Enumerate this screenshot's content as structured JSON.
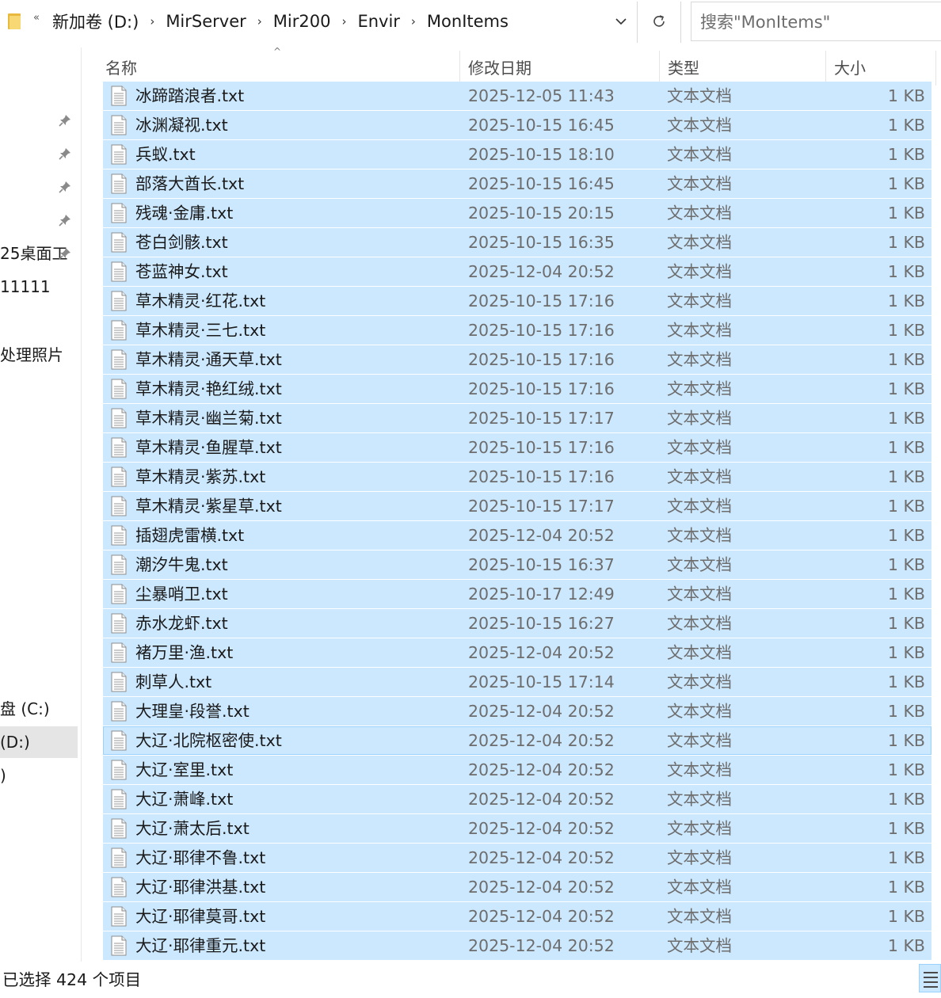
{
  "address_bar": {
    "crumbs": [
      "新加卷 (D:)",
      "MirServer",
      "Mir200",
      "Envir",
      "MonItems"
    ]
  },
  "search": {
    "placeholder": "搜索\"MonItems\""
  },
  "nav": {
    "items": [
      {
        "label": "",
        "pinned": true
      },
      {
        "label": "",
        "pinned": true
      },
      {
        "label": "",
        "pinned": true
      },
      {
        "label": "",
        "pinned": true
      },
      {
        "label": "25桌面工",
        "pinned": true
      },
      {
        "label": "11111",
        "pinned": false
      },
      {
        "label": "处理照片",
        "pinned": false
      },
      {
        "label": "盘 (C:)",
        "pinned": false
      },
      {
        "label": "(D:)",
        "pinned": false,
        "selected": true
      },
      {
        "label": ")",
        "pinned": false
      }
    ]
  },
  "columns": {
    "name": "名称",
    "date": "修改日期",
    "type": "类型",
    "size": "大小"
  },
  "files": [
    {
      "name": "冰蹄踏浪者.txt",
      "date": "2025-12-05 11:43",
      "type": "文本文档",
      "size": "1 KB"
    },
    {
      "name": "冰渊凝视.txt",
      "date": "2025-10-15 16:45",
      "type": "文本文档",
      "size": "1 KB"
    },
    {
      "name": "兵蚁.txt",
      "date": "2025-10-15 18:10",
      "type": "文本文档",
      "size": "1 KB"
    },
    {
      "name": "部落大酋长.txt",
      "date": "2025-10-15 16:45",
      "type": "文本文档",
      "size": "1 KB"
    },
    {
      "name": "残魂·金庸.txt",
      "date": "2025-10-15 20:15",
      "type": "文本文档",
      "size": "1 KB"
    },
    {
      "name": "苍白剑骸.txt",
      "date": "2025-10-15 16:35",
      "type": "文本文档",
      "size": "1 KB"
    },
    {
      "name": "苍蓝神女.txt",
      "date": "2025-12-04 20:52",
      "type": "文本文档",
      "size": "1 KB"
    },
    {
      "name": "草木精灵·红花.txt",
      "date": "2025-10-15 17:16",
      "type": "文本文档",
      "size": "1 KB"
    },
    {
      "name": "草木精灵·三七.txt",
      "date": "2025-10-15 17:16",
      "type": "文本文档",
      "size": "1 KB"
    },
    {
      "name": "草木精灵·通天草.txt",
      "date": "2025-10-15 17:16",
      "type": "文本文档",
      "size": "1 KB"
    },
    {
      "name": "草木精灵·艳红绒.txt",
      "date": "2025-10-15 17:16",
      "type": "文本文档",
      "size": "1 KB"
    },
    {
      "name": "草木精灵·幽兰菊.txt",
      "date": "2025-10-15 17:17",
      "type": "文本文档",
      "size": "1 KB"
    },
    {
      "name": "草木精灵·鱼腥草.txt",
      "date": "2025-10-15 17:16",
      "type": "文本文档",
      "size": "1 KB"
    },
    {
      "name": "草木精灵·紫苏.txt",
      "date": "2025-10-15 17:16",
      "type": "文本文档",
      "size": "1 KB"
    },
    {
      "name": "草木精灵·紫星草.txt",
      "date": "2025-10-15 17:17",
      "type": "文本文档",
      "size": "1 KB"
    },
    {
      "name": "插翅虎雷横.txt",
      "date": "2025-12-04 20:52",
      "type": "文本文档",
      "size": "1 KB"
    },
    {
      "name": "潮汐牛鬼.txt",
      "date": "2025-10-15 16:37",
      "type": "文本文档",
      "size": "1 KB"
    },
    {
      "name": "尘暴哨卫.txt",
      "date": "2025-10-17 12:49",
      "type": "文本文档",
      "size": "1 KB"
    },
    {
      "name": "赤水龙虾.txt",
      "date": "2025-10-15 16:27",
      "type": "文本文档",
      "size": "1 KB"
    },
    {
      "name": "褚万里·渔.txt",
      "date": "2025-12-04 20:52",
      "type": "文本文档",
      "size": "1 KB"
    },
    {
      "name": "刺草人.txt",
      "date": "2025-10-15 17:14",
      "type": "文本文档",
      "size": "1 KB"
    },
    {
      "name": "大理皇·段誉.txt",
      "date": "2025-12-04 20:52",
      "type": "文本文档",
      "size": "1 KB"
    },
    {
      "name": "大辽·北院枢密使.txt",
      "date": "2025-12-04 20:52",
      "type": "文本文档",
      "size": "1 KB",
      "focused": true
    },
    {
      "name": "大辽·室里.txt",
      "date": "2025-12-04 20:52",
      "type": "文本文档",
      "size": "1 KB"
    },
    {
      "name": "大辽·萧峰.txt",
      "date": "2025-12-04 20:52",
      "type": "文本文档",
      "size": "1 KB"
    },
    {
      "name": "大辽·萧太后.txt",
      "date": "2025-12-04 20:52",
      "type": "文本文档",
      "size": "1 KB"
    },
    {
      "name": "大辽·耶律不鲁.txt",
      "date": "2025-12-04 20:52",
      "type": "文本文档",
      "size": "1 KB"
    },
    {
      "name": "大辽·耶律洪基.txt",
      "date": "2025-12-04 20:52",
      "type": "文本文档",
      "size": "1 KB"
    },
    {
      "name": "大辽·耶律莫哥.txt",
      "date": "2025-12-04 20:52",
      "type": "文本文档",
      "size": "1 KB"
    },
    {
      "name": "大辽·耶律重元.txt",
      "date": "2025-12-04 20:52",
      "type": "文本文档",
      "size": "1 KB"
    }
  ],
  "status": {
    "text": "已选择 424 个项目"
  },
  "colors": {
    "selection": "#cce8ff",
    "selection_border": "#99d1ff",
    "folder": "#f8d775"
  },
  "icons": {
    "folder": "folder-icon",
    "back_history": "double-chevron-left-icon",
    "breadcrumb_sep": "chevron-right-icon",
    "dropdown": "chevron-down-icon",
    "refresh": "refresh-icon",
    "pin": "pin-icon",
    "file": "text-file-icon",
    "view": "details-view-icon"
  }
}
